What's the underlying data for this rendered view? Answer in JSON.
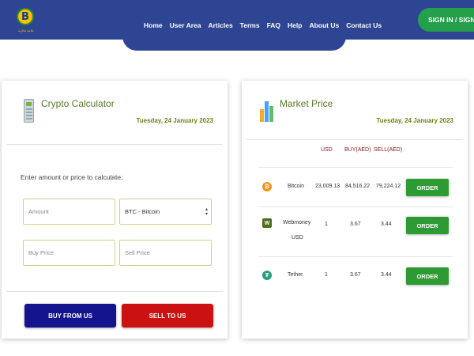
{
  "header": {
    "logo_text": "علامة تجارية",
    "logo_letter": "B",
    "nav": [
      "Home",
      "User Area",
      "Articles",
      "Terms",
      "FAQ",
      "Help",
      "About Us",
      "Contact Us"
    ],
    "signin": "SIGN IN / SIGN UP",
    "color": "#2e4593"
  },
  "calculator": {
    "title": "Crypto Calculator",
    "date": "Tuesday, 24 January 2023",
    "prompt": "Enter amount or price to calculate:",
    "amount_placeholder": "Amount",
    "currency_selected": "BTC - Bitcoin",
    "buy_price_placeholder": "Buy Price",
    "sell_price_placeholder": "Sell Price",
    "buy_button": "BUY FROM US",
    "sell_button": "SELL TO US"
  },
  "market": {
    "title": "Market Price",
    "date": "Tuesday, 24 January 2023",
    "columns": [
      "USD",
      "BUY(AED)",
      "SELL(AED)"
    ],
    "rows": [
      {
        "name": "Bitcoin",
        "icon": "bitcoin-icon",
        "usd": "23,009.13",
        "buy": "84,516.22",
        "sell": "79,224.12",
        "order": "ORDER"
      },
      {
        "name": "Webmoney USD",
        "icon": "webmoney-icon",
        "usd": "1",
        "buy": "3.67",
        "sell": "3.44",
        "order": "ORDER"
      },
      {
        "name": "Tether",
        "icon": "tether-icon",
        "usd": "1",
        "buy": "3.67",
        "sell": "3.44",
        "order": "ORDER"
      }
    ]
  },
  "colors": {
    "buy_button": "#14148f",
    "sell_button": "#cc1111",
    "order_button": "#2d9a34",
    "signin_button": "#24a04a"
  }
}
